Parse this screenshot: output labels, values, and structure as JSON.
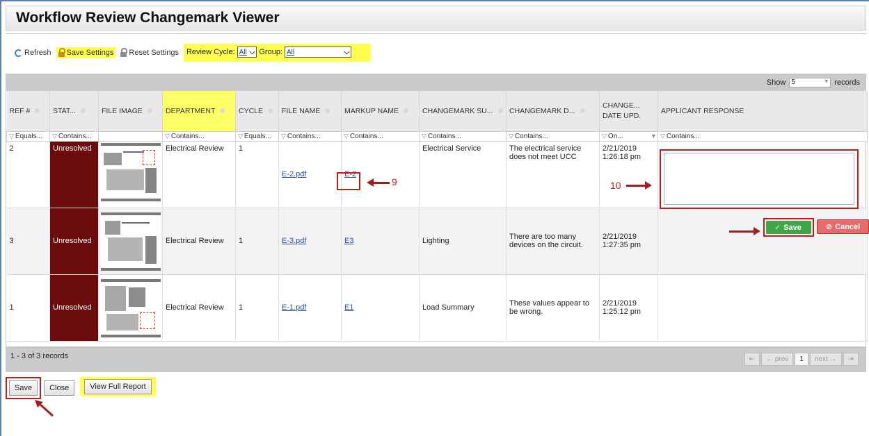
{
  "title": "Workflow Review Changemark Viewer",
  "toolbar": {
    "refresh": "Refresh",
    "save_settings": "Save Settings",
    "reset_settings": "Reset Settings",
    "review_cycle_label": "Review Cycle:",
    "review_cycle_value": "All",
    "group_label": "Group:",
    "group_value": "All"
  },
  "show": {
    "label": "Show",
    "value": "5",
    "records": "records"
  },
  "columns": [
    "REF #",
    "STAT...",
    "FILE IMAGE",
    "DEPARTMENT",
    "CYCLE",
    "FILE NAME",
    "MARKUP NAME",
    "CHANGEMARK SU...",
    "CHANGEMARK D...",
    "CHANGE... DATE UPD.",
    "APPLICANT RESPONSE"
  ],
  "filters": [
    "Equals...",
    "Contains...",
    "",
    "Contains...",
    "Equals...",
    "Contains...",
    "Contains...",
    "Contains...",
    "Contains...",
    "On...",
    "Contains..."
  ],
  "rows": [
    {
      "ref": "2",
      "status": "Unresolved",
      "dept": "Electrical Review",
      "cycle": "1",
      "file": "E-2.pdf",
      "markup": "E-2",
      "summary": "Electrical Service",
      "desc": "The electrical service does not meet UCC",
      "date": "2/21/2019",
      "time": "1:26:18 pm"
    },
    {
      "ref": "3",
      "status": "Unresolved",
      "dept": "Electrical Review",
      "cycle": "1",
      "file": "E-3.pdf",
      "markup": "E3",
      "summary": "Lighting",
      "desc": "There are too many devices on the circuit.",
      "date": "2/21/2019",
      "time": "1:27:35 pm"
    },
    {
      "ref": "1",
      "status": "Unresolved",
      "dept": "Electrical Review",
      "cycle": "1",
      "file": "E-1.pdf",
      "markup": "E1",
      "summary": "Load Summary",
      "desc": "These values appear to be wrong.",
      "date": "2/21/2019",
      "time": "1:25:12 pm"
    }
  ],
  "annotations": {
    "nine": "9",
    "ten": "10"
  },
  "row_buttons": {
    "save": "Save",
    "cancel": "Cancel"
  },
  "footer": {
    "count": "1 - 3 of 3 records",
    "first": "⇤",
    "prev": "← prev",
    "page": "1",
    "next": "next →",
    "last": "⇥"
  },
  "bottom": {
    "save": "Save",
    "close": "Close",
    "full_report": "View Full Report"
  }
}
